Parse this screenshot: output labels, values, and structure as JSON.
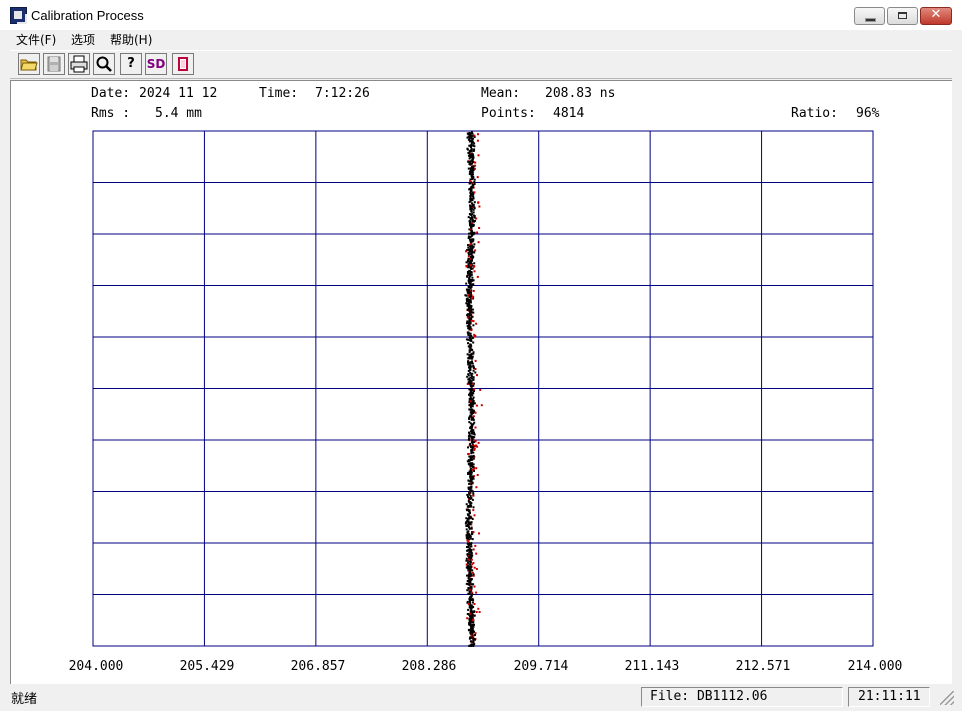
{
  "window": {
    "title": "Calibration Process",
    "controls": [
      "minimize",
      "maximize",
      "close"
    ],
    "close_glyph": "✕"
  },
  "menu": {
    "file": "文件(F)",
    "options": "选项",
    "help": "帮助(H)"
  },
  "toolbar": {
    "buttons": [
      {
        "icon": "open-folder-icon",
        "glyph": "📂"
      },
      {
        "icon": "save-icon",
        "glyph": "💾"
      },
      {
        "icon": "print-icon",
        "glyph": "⎙"
      },
      {
        "icon": "search-icon",
        "glyph": "🔍"
      },
      {
        "icon": "help-icon",
        "glyph": "?"
      },
      {
        "icon": "sd-icon",
        "glyph": "SD"
      },
      {
        "icon": "stop-icon",
        "glyph": "▯"
      }
    ],
    "accent_color": "#800080"
  },
  "info": {
    "date_label": "Date:",
    "date_value": "2024 11 12",
    "time_label": "Time:",
    "time_value": "7:12:26",
    "mean_label": "Mean:",
    "mean_value": "208.83 ns",
    "rms_label": "Rms :",
    "rms_value": "5.4 mm",
    "points_label": "Points:",
    "points_value": "4814",
    "ratio_label": "Ratio:",
    "ratio_value": "96%"
  },
  "chart_data": {
    "type": "scatter",
    "x_ticks": [
      "204.000",
      "205.429",
      "206.857",
      "208.286",
      "209.714",
      "211.143",
      "212.571",
      "214.000"
    ],
    "xlim": [
      204.0,
      214.0
    ],
    "grid": true,
    "grid_rows": 10,
    "grid_cols": 7,
    "grid_color": "#000080",
    "point_colors": [
      "#000000",
      "#cc0000"
    ],
    "cluster_center_x": 208.83,
    "cluster_spread_x": 0.06
  },
  "status": {
    "ready": "就绪",
    "file": "File: DB1112.06",
    "clock": "21:11:11"
  }
}
